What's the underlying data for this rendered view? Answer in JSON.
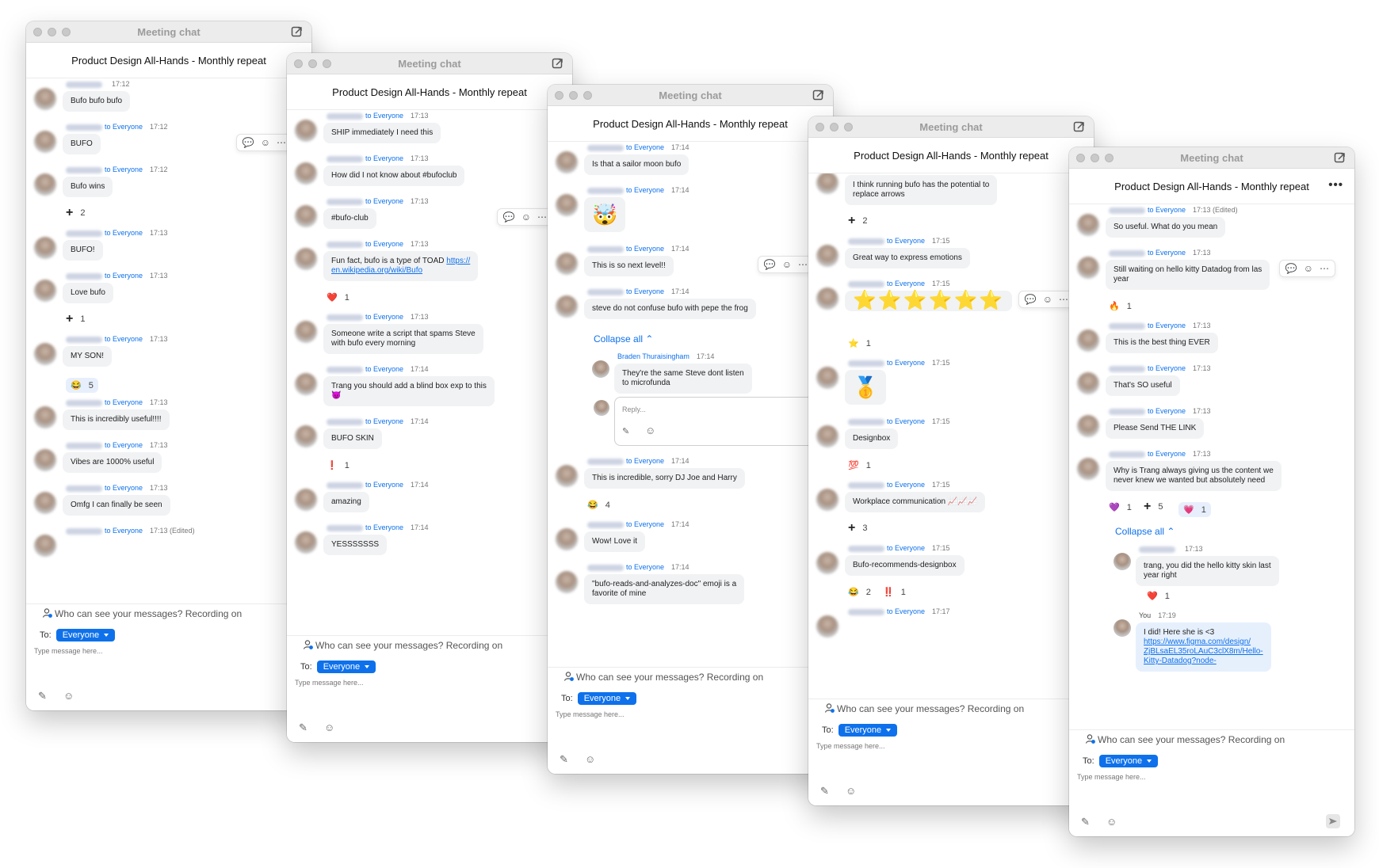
{
  "app": {
    "window_title": "Meeting chat",
    "meeting_name": "Product Design All-Hands - Monthly repeat",
    "to_label": "To:",
    "recipient": "Everyone",
    "placeholder": "Type message here...",
    "notice": "Who can see your messages? Recording on",
    "to_everyone": "to Everyone",
    "collapse_all": "Collapse all",
    "reply_placeholder": "Reply..."
  },
  "colors": {
    "accent": "#0e71eb",
    "bubble": "#f1f2f4"
  },
  "windows": [
    {
      "items": [
        {
          "kind": "msg",
          "to": "",
          "time": "17:12",
          "text": "Bufo bufo bufo"
        },
        {
          "kind": "msg",
          "to": "to Everyone",
          "time": "17:12",
          "text": "BUFO",
          "hover": true
        },
        {
          "kind": "msg",
          "to": "to Everyone",
          "time": "17:12",
          "text": "Bufo wins"
        },
        {
          "kind": "react",
          "chips": [
            {
              "icon": "plus",
              "count": "2"
            }
          ]
        },
        {
          "kind": "msg",
          "to": "to Everyone",
          "time": "17:13",
          "text": "BUFO!"
        },
        {
          "kind": "msg",
          "to": "to Everyone",
          "time": "17:13",
          "text": "Love bufo"
        },
        {
          "kind": "react",
          "chips": [
            {
              "icon": "plus",
              "count": "1"
            }
          ]
        },
        {
          "kind": "msg",
          "to": "to Everyone",
          "time": "17:13",
          "text": "MY SON!"
        },
        {
          "kind": "react",
          "chips": [
            {
              "icon": "😂",
              "count": "5",
              "hl": true
            }
          ]
        },
        {
          "kind": "msg",
          "to": "to Everyone",
          "time": "17:13",
          "text": "This is incredibly useful!!!!"
        },
        {
          "kind": "msg",
          "to": "to Everyone",
          "time": "17:13",
          "text": "Vibes are 1000% useful"
        },
        {
          "kind": "msg",
          "to": "to Everyone",
          "time": "17:13",
          "text": "Omfg I can finally be seen"
        },
        {
          "kind": "msg",
          "to": "to Everyone",
          "time": "17:13 (Edited)",
          "text": ""
        }
      ]
    },
    {
      "items": [
        {
          "kind": "msg",
          "to": "to Everyone",
          "time": "17:13",
          "text": "SHIP immediately I need this"
        },
        {
          "kind": "msg",
          "to": "to Everyone",
          "time": "17:13",
          "text": "How did I not know about #bufoclub"
        },
        {
          "kind": "msg",
          "to": "to Everyone",
          "time": "17:13",
          "text": "#bufo-club",
          "hover": true
        },
        {
          "kind": "msg",
          "to": "to Everyone",
          "time": "17:13",
          "text": "Fun fact, bufo is a type of TOAD https://",
          "text2": "en.wikipedia.org/wiki/Bufo",
          "tall": true
        },
        {
          "kind": "react",
          "chips": [
            {
              "icon": "❤️",
              "count": "1"
            }
          ]
        },
        {
          "kind": "msg",
          "to": "to Everyone",
          "time": "17:13",
          "text": "Someone write a script that spams Steve",
          "text2": "with bufo every morning",
          "tall": true
        },
        {
          "kind": "msg",
          "to": "to Everyone",
          "time": "17:14",
          "text": "Trang you should add a blind box exp to this",
          "text2": "😈",
          "tall": true
        },
        {
          "kind": "msg",
          "to": "to Everyone",
          "time": "17:14",
          "text": "BUFO SKIN"
        },
        {
          "kind": "react",
          "chips": [
            {
              "icon": "❗",
              "count": "1"
            }
          ]
        },
        {
          "kind": "msg",
          "to": "to Everyone",
          "time": "17:14",
          "text": "amazing"
        },
        {
          "kind": "msg",
          "to": "to Everyone",
          "time": "17:14",
          "text": "YESSSSSSS"
        }
      ]
    },
    {
      "items": [
        {
          "kind": "msg",
          "to": "to Everyone",
          "time": "17:14",
          "text": "Is that a sailor moon bufo"
        },
        {
          "kind": "msg",
          "to": "to Everyone",
          "time": "17:14",
          "text": "🤯",
          "big": true
        },
        {
          "kind": "msg",
          "to": "to Everyone",
          "time": "17:14",
          "text": "This is so next level!!",
          "hover": true
        },
        {
          "kind": "msg",
          "to": "to Everyone",
          "time": "17:14",
          "text": "steve do not confuse bufo with pepe the frog"
        },
        {
          "kind": "collapse"
        },
        {
          "kind": "thread",
          "name": "Braden Thuraisingham",
          "time": "17:14",
          "text": "They're the same Steve dont listen",
          "text2": "to microfunda"
        },
        {
          "kind": "replybox"
        },
        {
          "kind": "msg",
          "to": "to Everyone",
          "time": "17:14",
          "text": "This is incredible, sorry DJ Joe and Harry"
        },
        {
          "kind": "react",
          "chips": [
            {
              "icon": "😂",
              "count": "4"
            }
          ]
        },
        {
          "kind": "msg",
          "to": "to Everyone",
          "time": "17:14",
          "text": "Wow! Love it"
        },
        {
          "kind": "msg",
          "to": "to Everyone",
          "time": "17:14",
          "text": "\"bufo-reads-and-analyzes-doc\" emoji is a",
          "text2": "favorite of mine",
          "tall": true
        }
      ]
    },
    {
      "items": [
        {
          "kind": "msg",
          "to": "",
          "time": "",
          "text": "I think running bufo has the potential to",
          "text2": "replace arrows",
          "tall": true,
          "cut": true
        },
        {
          "kind": "react",
          "chips": [
            {
              "icon": "plus",
              "count": "2"
            }
          ]
        },
        {
          "kind": "msg",
          "to": "to Everyone",
          "time": "17:15",
          "text": "Great way to express emotions"
        },
        {
          "kind": "msg",
          "to": "to Everyone",
          "time": "17:15",
          "text": "⭐⭐⭐⭐⭐⭐",
          "stars": true,
          "hover": true
        },
        {
          "kind": "react",
          "chips": [
            {
              "icon": "⭐",
              "count": "1"
            }
          ]
        },
        {
          "kind": "msg",
          "to": "to Everyone",
          "time": "17:15",
          "text": "🥇",
          "big": true
        },
        {
          "kind": "msg",
          "to": "to Everyone",
          "time": "17:15",
          "text": "Designbox"
        },
        {
          "kind": "react",
          "chips": [
            {
              "icon": "💯",
              "count": "1"
            }
          ]
        },
        {
          "kind": "msg",
          "to": "to Everyone",
          "time": "17:15",
          "text": "Workplace communication 📈📈📈"
        },
        {
          "kind": "react",
          "chips": [
            {
              "icon": "plus",
              "count": "3"
            }
          ]
        },
        {
          "kind": "msg",
          "to": "to Everyone",
          "time": "17:15",
          "text": "Bufo-recommends-designbox"
        },
        {
          "kind": "react",
          "chips": [
            {
              "icon": "😂",
              "count": "2"
            },
            {
              "icon": "‼️",
              "count": "1"
            }
          ]
        },
        {
          "kind": "msg",
          "to": "to Everyone",
          "time": "17:17",
          "text": ""
        }
      ]
    },
    {
      "items": [
        {
          "kind": "msg",
          "to": "to Everyone",
          "time": "17:13 (Edited)",
          "text": "So useful. What do you mean"
        },
        {
          "kind": "msg",
          "to": "to Everyone",
          "time": "17:13",
          "text": "Still waiting on hello kitty Datadog from las",
          "text2": "year",
          "tall": true,
          "hover": true
        },
        {
          "kind": "react",
          "chips": [
            {
              "icon": "🔥",
              "count": "1"
            }
          ]
        },
        {
          "kind": "msg",
          "to": "to Everyone",
          "time": "17:13",
          "text": "This is the best thing EVER"
        },
        {
          "kind": "msg",
          "to": "to Everyone",
          "time": "17:13",
          "text": "That's SO useful"
        },
        {
          "kind": "msg",
          "to": "to Everyone",
          "time": "17:13",
          "text": "Please Send THE LINK"
        },
        {
          "kind": "msg",
          "to": "to Everyone",
          "time": "17:13",
          "text": "Why is Trang always giving us the content we",
          "text2": "never knew we wanted but absolutely need",
          "tall": true
        },
        {
          "kind": "react",
          "chips": [
            {
              "icon": "💜",
              "count": "1"
            },
            {
              "icon": "plus",
              "count": "5"
            },
            {
              "icon": "💗",
              "count": "1",
              "hl": true
            }
          ]
        },
        {
          "kind": "collapse"
        },
        {
          "kind": "thread",
          "name": "",
          "time": "17:13",
          "text": "trang, you did the hello kitty skin last",
          "text2": "year right"
        },
        {
          "kind": "threadreact",
          "chips": [
            {
              "icon": "❤️",
              "count": "1"
            }
          ]
        },
        {
          "kind": "thread",
          "name": "You",
          "time": "17:19",
          "text": "I did! Here she is <3",
          "link": "https://www.figma.com/design/",
          "link2": "ZjBLsaEL35roLAuC3clX8m/Hello-",
          "link3": "Kitty-Datadog?node-",
          "blue": true
        }
      ]
    }
  ]
}
